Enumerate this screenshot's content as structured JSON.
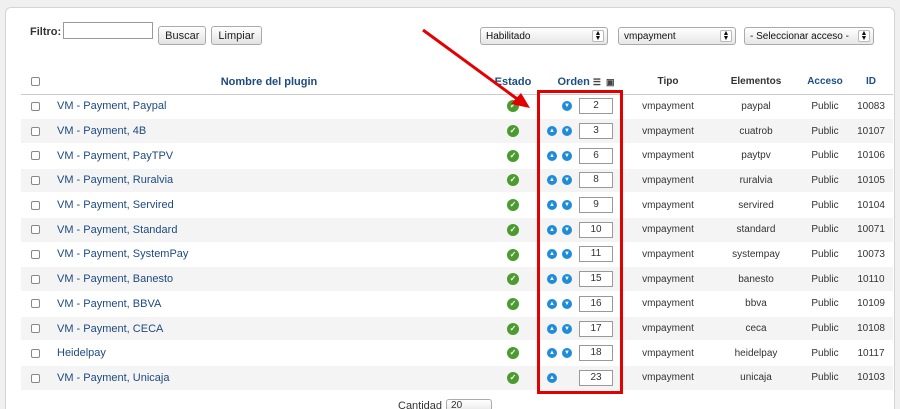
{
  "filter": {
    "label": "Filtro:",
    "value": "",
    "search_button": "Buscar",
    "clear_button": "Limpiar"
  },
  "selects": {
    "status": "Habilitado",
    "type": "vmpayment",
    "access": "- Seleccionar acceso -"
  },
  "columns": {
    "name": "Nombre del plugin",
    "estado": "Estado",
    "orden": "Orden",
    "tipo": "Tipo",
    "elementos": "Elementos",
    "acceso": "Acceso",
    "id": "ID"
  },
  "rows": [
    {
      "name": "VM - Payment, Paypal",
      "order": "2",
      "up": false,
      "down": true,
      "tipo": "vmpayment",
      "elemento": "paypal",
      "acceso": "Public",
      "id": "10083"
    },
    {
      "name": "VM - Payment, 4B",
      "order": "3",
      "up": true,
      "down": true,
      "tipo": "vmpayment",
      "elemento": "cuatrob",
      "acceso": "Public",
      "id": "10107"
    },
    {
      "name": "VM - Payment, PayTPV",
      "order": "6",
      "up": true,
      "down": true,
      "tipo": "vmpayment",
      "elemento": "paytpv",
      "acceso": "Public",
      "id": "10106"
    },
    {
      "name": "VM - Payment, Ruralvia",
      "order": "8",
      "up": true,
      "down": true,
      "tipo": "vmpayment",
      "elemento": "ruralvia",
      "acceso": "Public",
      "id": "10105"
    },
    {
      "name": "VM - Payment, Servired",
      "order": "9",
      "up": true,
      "down": true,
      "tipo": "vmpayment",
      "elemento": "servired",
      "acceso": "Public",
      "id": "10104"
    },
    {
      "name": "VM - Payment, Standard",
      "order": "10",
      "up": true,
      "down": true,
      "tipo": "vmpayment",
      "elemento": "standard",
      "acceso": "Public",
      "id": "10071"
    },
    {
      "name": "VM - Payment, SystemPay",
      "order": "11",
      "up": true,
      "down": true,
      "tipo": "vmpayment",
      "elemento": "systempay",
      "acceso": "Public",
      "id": "10073"
    },
    {
      "name": "VM - Payment, Banesto",
      "order": "15",
      "up": true,
      "down": true,
      "tipo": "vmpayment",
      "elemento": "banesto",
      "acceso": "Public",
      "id": "10110"
    },
    {
      "name": "VM - Payment, BBVA",
      "order": "16",
      "up": true,
      "down": true,
      "tipo": "vmpayment",
      "elemento": "bbva",
      "acceso": "Public",
      "id": "10109"
    },
    {
      "name": "VM - Payment, CECA",
      "order": "17",
      "up": true,
      "down": true,
      "tipo": "vmpayment",
      "elemento": "ceca",
      "acceso": "Public",
      "id": "10108"
    },
    {
      "name": "Heidelpay",
      "order": "18",
      "up": true,
      "down": true,
      "tipo": "vmpayment",
      "elemento": "heidelpay",
      "acceso": "Public",
      "id": "10117"
    },
    {
      "name": "VM - Payment, Unicaja",
      "order": "23",
      "up": true,
      "down": false,
      "tipo": "vmpayment",
      "elemento": "unicaja",
      "acceso": "Public",
      "id": "10103"
    }
  ],
  "footer": {
    "label": "Cantidad",
    "value": "20"
  },
  "colors": {
    "highlight": "#e30000",
    "link": "#1d4a80",
    "published": "#4b9b2f",
    "order_arrow": "#1f8cd8"
  }
}
